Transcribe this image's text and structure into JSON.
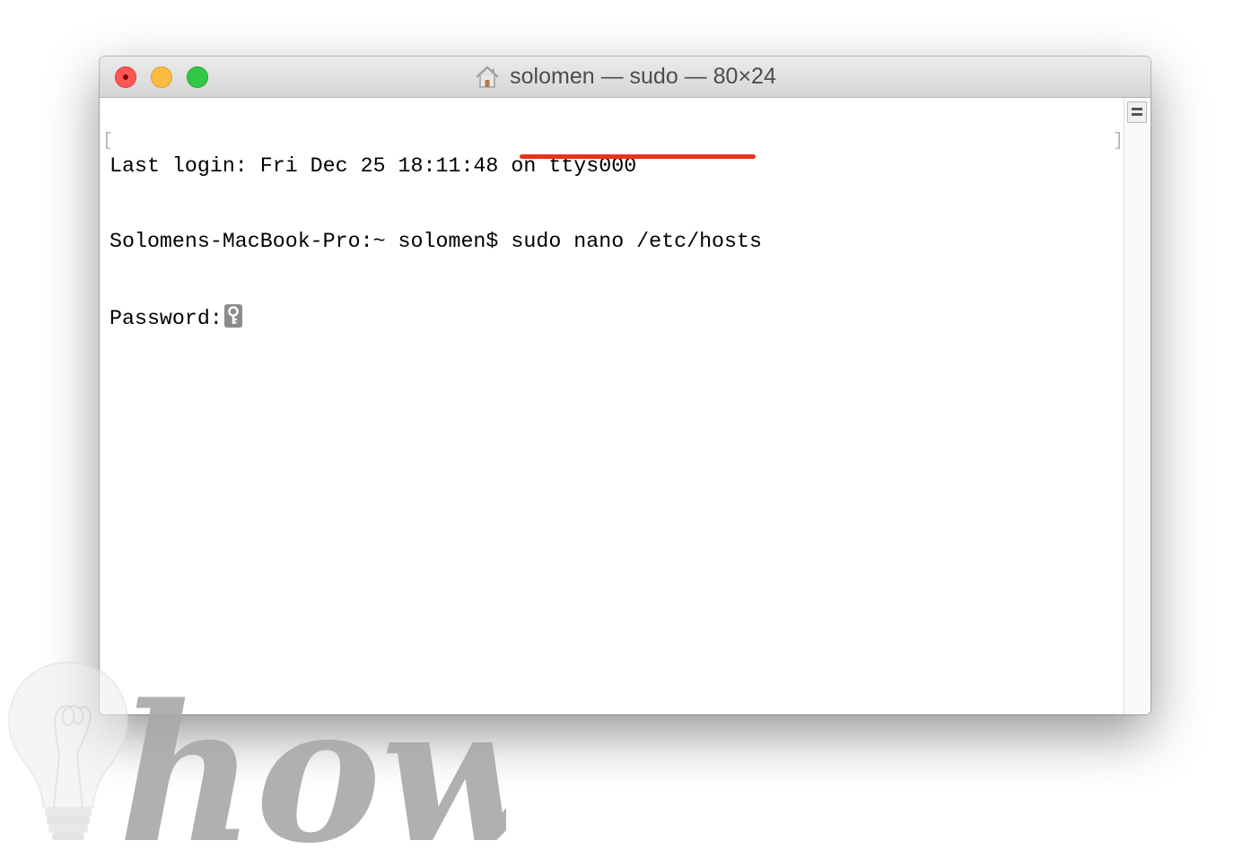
{
  "window": {
    "title": "solomen — sudo — 80×24",
    "title_icon": "home-icon"
  },
  "traffic_lights": {
    "close": "#fc5753",
    "minimize": "#fdbc40",
    "maximize": "#33c748"
  },
  "terminal": {
    "lines": [
      "Last login: Fri Dec 25 18:11:48 on ttys000",
      "Solomens-MacBook-Pro:~ solomen$ ",
      "Password:"
    ],
    "command": "sudo nano /etc/hosts",
    "password_cursor_icon": "key-icon",
    "annotation_color": "#e8321a"
  },
  "watermark": {
    "text": "how",
    "icon": "lightbulb-icon"
  }
}
